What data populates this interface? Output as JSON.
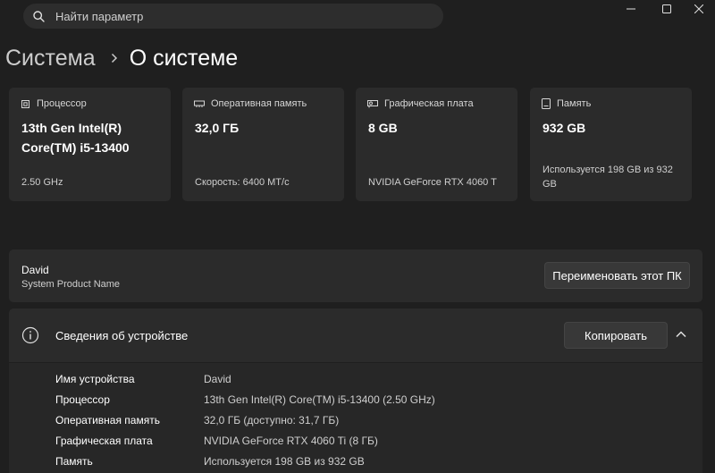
{
  "search": {
    "placeholder": "Найти параметр"
  },
  "breadcrumb": {
    "parent": "Система",
    "current": "О системе"
  },
  "cards": [
    {
      "header": "Процессор",
      "value": "13th Gen Intel(R) Core(TM) i5-13400",
      "sub": "2.50 GHz",
      "icon": "processor-icon"
    },
    {
      "header": "Оперативная память",
      "value": "32,0 ГБ",
      "sub": "Скорость: 6400 МТ/с",
      "icon": "ram-icon"
    },
    {
      "header": "Графическая плата",
      "value": "8 GB",
      "sub": "NVIDIA GeForce RTX 4060 T",
      "icon": "gpu-icon"
    },
    {
      "header": "Память",
      "value": "932 GB",
      "sub": "Используется 198 GB из 932 GB",
      "icon": "storage-icon"
    }
  ],
  "pc": {
    "name": "David",
    "model": "System Product Name",
    "rename_label": "Переименовать этот ПК"
  },
  "device_specs": {
    "title": "Сведения об устройстве",
    "copy_label": "Копировать",
    "rows": [
      {
        "key": "Имя устройства",
        "value": "David"
      },
      {
        "key": "Процессор",
        "value": "13th Gen Intel(R) Core(TM) i5-13400 (2.50 GHz)"
      },
      {
        "key": "Оперативная память",
        "value": "32,0 ГБ (доступно: 31,7 ГБ)"
      },
      {
        "key": "Графическая плата",
        "value": "NVIDIA GeForce RTX 4060 Ti (8 ГБ)"
      },
      {
        "key": "Память",
        "value": "Используется 198 GB из 932 GB"
      }
    ]
  },
  "colors": {
    "background": "#1f1f1f",
    "card": "#2b2b2b",
    "button": "#383838"
  }
}
